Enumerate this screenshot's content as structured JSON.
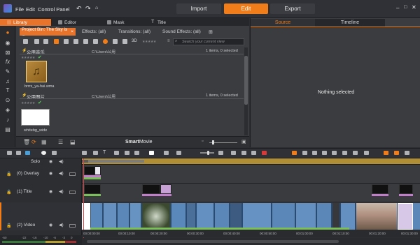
{
  "menu": {
    "file": "File",
    "edit": "Edit",
    "control_panel": "Control Panel"
  },
  "modes": {
    "import": "Import",
    "edit": "Edit",
    "export": "Export"
  },
  "top_tabs": [
    {
      "label": "Library",
      "active": true
    },
    {
      "label": "Editor",
      "active": false
    },
    {
      "label": "Mask",
      "active": false
    },
    {
      "label": "Title",
      "active": false
    }
  ],
  "library": {
    "bin_tab": "Project Bin: The Sky is ...",
    "bin_close": "×",
    "subtabs": [
      "Effects: (all)",
      "Transitions: (all)",
      "Sound Effects: (all)"
    ],
    "view_3d": "3D",
    "rating": "★★★★★",
    "search_placeholder": "Search your current view",
    "groups": [
      {
        "name": "公用音乐",
        "path": "C:\\Users\\公用",
        "count": "1 items, 0 selected",
        "file": "brrrs_ya-hai.wma"
      },
      {
        "name": "公用图片",
        "path": "C:\\Users\\公用",
        "count": "1 items, 0 selected",
        "file": "whitebg_wide"
      }
    ],
    "smartmovie_bold": "Smart",
    "smartmovie_rest": "Movie"
  },
  "right_panel": {
    "tab_source": "Source",
    "tab_timeline": "Timeline",
    "empty_message": "Nothing selected"
  },
  "tracks": [
    {
      "label": "Solo"
    },
    {
      "label": "(0) Overlay"
    },
    {
      "label": "(1) Title"
    },
    {
      "label": "(2) Video"
    }
  ],
  "ruler_ticks": [
    "00:00:00:00",
    "00:00:10:00",
    "00:00:20:00",
    "00:00:30:00",
    "00:00:40:00",
    "00:00:50:00",
    "00:01:00:00",
    "00:01:10:00",
    "00:01:20:00",
    "00:01:30:00"
  ],
  "meter_labels": [
    "-60",
    "-22",
    "-16",
    "-10",
    "-6",
    "-3",
    "0"
  ],
  "colors": {
    "accent": "#f07d1a",
    "video_track": "#5a86b8",
    "solo_bar": "#b08e35"
  }
}
